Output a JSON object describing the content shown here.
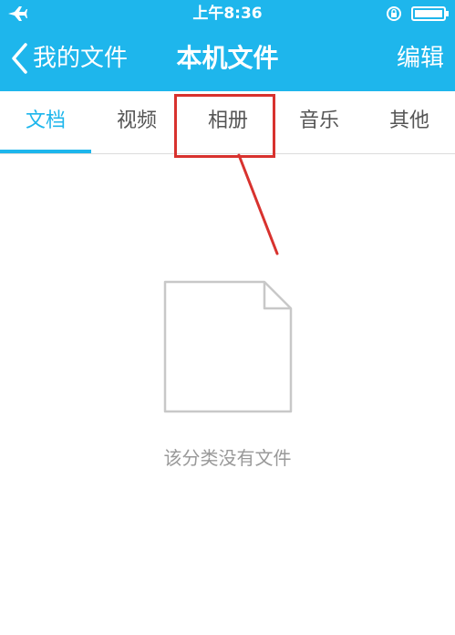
{
  "status_bar": {
    "time": "上午8:36",
    "icons": [
      "airplane-icon",
      "rotation-lock-icon",
      "battery-icon"
    ]
  },
  "nav": {
    "back_label": "我的文件",
    "title": "本机文件",
    "edit_label": "编辑"
  },
  "tabs": [
    {
      "label": "文档",
      "active": true
    },
    {
      "label": "视频",
      "active": false
    },
    {
      "label": "相册",
      "active": false
    },
    {
      "label": "音乐",
      "active": false
    },
    {
      "label": "其他",
      "active": false
    }
  ],
  "empty_state": {
    "icon": "blank-file-icon",
    "message": "该分类没有文件"
  },
  "colors": {
    "accent": "#1eb6ec",
    "annotation": "#d8322e",
    "muted_text": "#999999"
  }
}
